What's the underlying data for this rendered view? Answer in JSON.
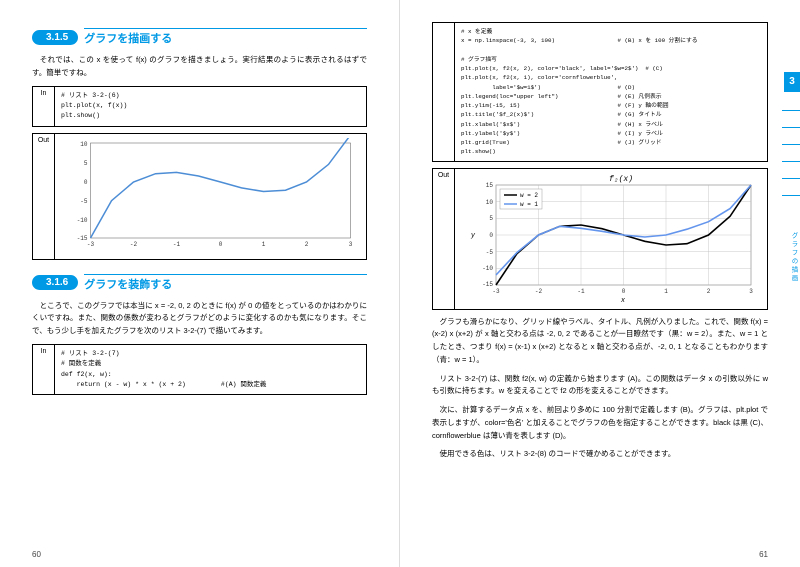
{
  "left": {
    "sec1": {
      "num": "3.1.5",
      "title": "グラフを描画する"
    },
    "para1": "　それでは、この x を使って f(x) のグラフを描きましょう。実行結果のように表示されるはずです。簡単ですね。",
    "code1": {
      "label": "In",
      "body": "# リスト 3-2-(6)\nplt.plot(x, f(x))\nplt.show()"
    },
    "code2": {
      "label": "Out"
    },
    "sec2": {
      "num": "3.1.6",
      "title": "グラフを装飾する"
    },
    "para2": "　ところで、このグラフでは本当に x = -2, 0, 2 のときに f(x) が 0 の値をとっているのかはわかりにくいですね。また、関数の係数が変わるとグラフがどのように変化するのかも気になります。そこで、もう少し手を加えたグラフを次のリスト 3-2-(7) で描いてみます。",
    "code3": {
      "label": "In",
      "body": "# リスト 3-2-(7)\n# 関数を定義\ndef f2(x, w):\n    return (x - w) * x * (x + 2)         #(A) 関数定義"
    },
    "pagenum": "60"
  },
  "right": {
    "code4": {
      "body": "# x を定義\nx = np.linspace(-3, 3, 100)                  # (B) x を 100 分割にする\n\n# グラフ描写\nplt.plot(x, f2(x, 2), color='black', label='$w=2$')  # (C)\nplt.plot(x, f2(x, 1), color='cornflowerblue',\n         label='$w=1$')                      # (D)\nplt.legend(loc=\"upper left\")                 # (E) 凡例表示\nplt.ylim(-15, 15)                            # (F) y 軸の範囲\nplt.title('$f_2(x)$')                        # (G) タイトル\nplt.xlabel('$x$')                            # (H) x ラベル\nplt.ylabel('$y$')                            # (I) y ラベル\nplt.grid(True)                               # (J) グリッド\nplt.show()"
    },
    "code5": {
      "label": "Out"
    },
    "para3": "　グラフも滑らかになり、グリッド線やラベル、タイトル、凡例が入りました。これで、関数 f(x) = (x-2) x (x+2) が x 軸と交わる点は -2, 0, 2 であることが一目瞭然です（黒：w = 2）。また、w = 1 としたとき、つまり f(x) = (x-1) x (x+2) となると x 軸と交わる点が、-2, 0, 1 となることもわかります（青：w = 1）。",
    "para4": "　リスト 3-2-(7) は、関数 f2(x, w) の定義から始まります (A)。この関数はデータ x の引数以外に w も引数に持ちます。w を変えることで f2 の形を変えることができます。",
    "para5": "　次に、計算するデータ点 x を、前回より多めに 100 分割で定義します (B)。グラフは、plt.plot で表示しますが、color='色名' と加えることでグラフの色を指定することができます。black は黒 (C)、cornflowerblue は薄い青を表します (D)。",
    "para6": "　使用できる色は、リスト 3-2-(8) のコードで確かめることができます。",
    "pagenum": "61",
    "thumb": "3",
    "tab": "グラフの描画"
  },
  "chart_data": [
    {
      "type": "line",
      "title": "",
      "xlabel": "",
      "ylabel": "",
      "xlim": [
        -3,
        3
      ],
      "ylim": [
        -15,
        15
      ],
      "x_ticks": [
        -3,
        -2,
        -1,
        0,
        1,
        2,
        3
      ],
      "y_ticks": [
        -15,
        -10,
        -5,
        0,
        5,
        10
      ],
      "grid": false,
      "series": [
        {
          "name": "f(x)",
          "color": "#4c8dd6",
          "x": [
            -3,
            -2.5,
            -2,
            -1.5,
            -1,
            -0.5,
            0,
            0.5,
            1,
            1.5,
            2,
            2.5,
            3
          ],
          "y": [
            -15,
            -5.6,
            0,
            2.6,
            3,
            1.9,
            0,
            -1.9,
            -3,
            -2.6,
            0,
            5.6,
            15
          ]
        }
      ]
    },
    {
      "type": "line",
      "title": "f₂(x)",
      "xlabel": "x",
      "ylabel": "y",
      "xlim": [
        -3,
        3
      ],
      "ylim": [
        -15,
        15
      ],
      "x_ticks": [
        -3,
        -2,
        -1,
        0,
        1,
        2,
        3
      ],
      "y_ticks": [
        -15,
        -10,
        -5,
        0,
        5,
        10,
        15
      ],
      "grid": true,
      "legend_loc": "upper left",
      "series": [
        {
          "name": "w = 2",
          "color": "#000000",
          "x": [
            -3,
            -2.5,
            -2,
            -1.5,
            -1,
            -0.5,
            0,
            0.5,
            1,
            1.5,
            2,
            2.5,
            3
          ],
          "y": [
            -15,
            -5.6,
            0,
            2.6,
            3,
            1.9,
            0,
            -1.9,
            -3,
            -2.6,
            0,
            5.6,
            15
          ]
        },
        {
          "name": "w = 1",
          "color": "#6495ed",
          "x": [
            -3,
            -2.5,
            -2,
            -1.5,
            -1,
            -0.5,
            0,
            0.5,
            1,
            1.5,
            2,
            2.5,
            3
          ],
          "y": [
            -12,
            -5.25,
            0,
            2.6,
            2,
            1.1,
            0,
            -0.6,
            0,
            1.75,
            4,
            7.9,
            15
          ]
        }
      ]
    }
  ]
}
